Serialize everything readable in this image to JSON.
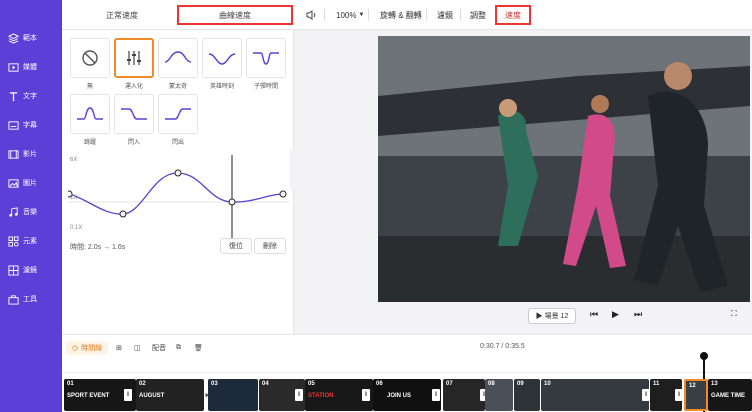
{
  "sidebar": {
    "items": [
      {
        "label": "範本",
        "icon": "template-icon"
      },
      {
        "label": "媒體",
        "icon": "media-icon"
      },
      {
        "label": "文字",
        "icon": "text-icon"
      },
      {
        "label": "字幕",
        "icon": "subtitle-icon"
      },
      {
        "label": "影片",
        "icon": "video-icon"
      },
      {
        "label": "圖片",
        "icon": "image-icon"
      },
      {
        "label": "音樂",
        "icon": "music-icon"
      },
      {
        "label": "元素",
        "icon": "elements-icon"
      },
      {
        "label": "濾鏡",
        "icon": "filter-icon"
      },
      {
        "label": "工具",
        "icon": "tools-icon"
      }
    ]
  },
  "topbar": {
    "tab_normal": "正常速度",
    "tab_curve": "曲線速度",
    "zoom": "100%",
    "rotate": "旋轉 & 翻轉",
    "filter": "濾鏡",
    "adjust": "調整",
    "speed": "速度"
  },
  "presets": [
    {
      "label": "無"
    },
    {
      "label": "運入化"
    },
    {
      "label": "蒙太奇"
    },
    {
      "label": "英雄時刻"
    },
    {
      "label": "子彈時間"
    },
    {
      "label": "跳躍"
    },
    {
      "label": "閃入"
    },
    {
      "label": "閃出"
    }
  ],
  "graph": {
    "y_top": "6X",
    "y_mid": "1X",
    "y_bottom": "0.1X"
  },
  "duration": "時間:  2.0s → 1.6s",
  "buttons": {
    "reset": "復位",
    "delete": "刪除"
  },
  "player": {
    "scene": "▶ 場景 12"
  },
  "timeline": {
    "timeline_btn": "時間線",
    "audio_btn": "配音",
    "time": "0:30.7 / 0:35.5",
    "clips": [
      {
        "num": "01",
        "text": "SPORT EVENT"
      },
      {
        "num": "02",
        "text": "AUGUST"
      },
      {
        "num": "03",
        "text": ""
      },
      {
        "num": "04",
        "text": ""
      },
      {
        "num": "05",
        "text": "STATION"
      },
      {
        "num": "06",
        "text": "JOIN US"
      },
      {
        "num": "07",
        "text": ""
      },
      {
        "num": "08",
        "text": ""
      },
      {
        "num": "09",
        "text": ""
      },
      {
        "num": "10",
        "text": ""
      },
      {
        "num": "11",
        "text": ""
      },
      {
        "num": "12",
        "text": ""
      },
      {
        "num": "13",
        "text": "GAME TIME"
      }
    ]
  },
  "colors": {
    "sidebar": "#5b3fd6",
    "accent": "#f08a2a",
    "highlight": "#e33333"
  }
}
